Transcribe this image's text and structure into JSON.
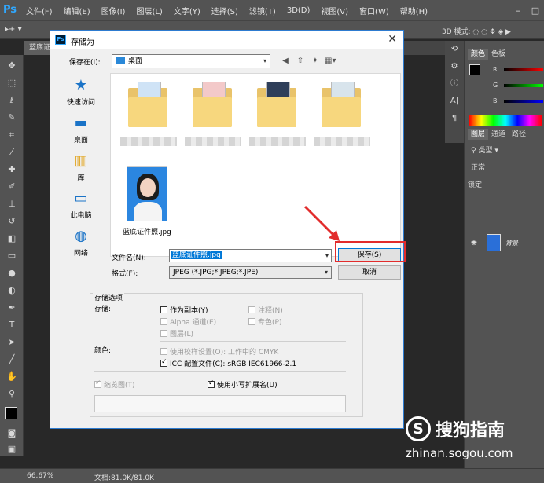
{
  "app": {
    "logo": "Ps",
    "menus": [
      "文件(F)",
      "编辑(E)",
      "图像(I)",
      "图层(L)",
      "文字(Y)",
      "选择(S)",
      "滤镜(T)",
      "3D(D)",
      "视图(V)",
      "窗口(W)",
      "帮助(H)"
    ],
    "mode3d_label": "3D 模式:",
    "doc_tab": "蓝底证",
    "status": {
      "zoom": "66.67%",
      "doc_info": "文档:81.0K/81.0K"
    },
    "right_panel": {
      "color_tabs": [
        "颜色",
        "色板"
      ],
      "rgb_labels": [
        "R",
        "G",
        "B"
      ],
      "layer_tabs": [
        "图层",
        "通道",
        "路径"
      ],
      "kind_label": "类型",
      "blend_mode": "正常",
      "lock_label": "锁定:",
      "layer_name": "背景"
    }
  },
  "dialog": {
    "title": "存储为",
    "save_in_label": "保存在(I):",
    "save_in_value": "桌面",
    "places": [
      {
        "label": "快速访问",
        "icon": "star-icon"
      },
      {
        "label": "桌面",
        "icon": "desktop-icon"
      },
      {
        "label": "库",
        "icon": "library-icon"
      },
      {
        "label": "此电脑",
        "icon": "computer-icon"
      },
      {
        "label": "网络",
        "icon": "network-icon"
      }
    ],
    "files": [
      {
        "type": "folder"
      },
      {
        "type": "folder"
      },
      {
        "type": "folder"
      },
      {
        "type": "folder"
      },
      {
        "type": "image",
        "name": "蓝底证件照.jpg"
      }
    ],
    "filename_label": "文件名(N):",
    "filename_value": "蓝底证件照.jpg",
    "format_label": "格式(F):",
    "format_value": "JPEG (*.JPG;*.JPEG;*.JPE)",
    "save_button": "保存(S)",
    "cancel_button": "取消",
    "options": {
      "group_title": "存储选项",
      "save_label": "存储:",
      "as_copy": "作为副本(Y)",
      "notes": "注释(N)",
      "alpha": "Alpha 通道(E)",
      "spot": "专色(P)",
      "layers": "图层(L)",
      "color_label": "颜色:",
      "proof": "使用校样设置(O):",
      "proof_value": "工作中的 CMYK",
      "icc": "ICC 配置文件(C):",
      "icc_value": "sRGB IEC61966-2.1",
      "thumbnail": "缩览图(T)",
      "lowercase": "使用小写扩展名(U)"
    }
  },
  "watermark": {
    "logo": "S",
    "text": "搜狗指南",
    "url": "zhinan.sogou.com"
  }
}
